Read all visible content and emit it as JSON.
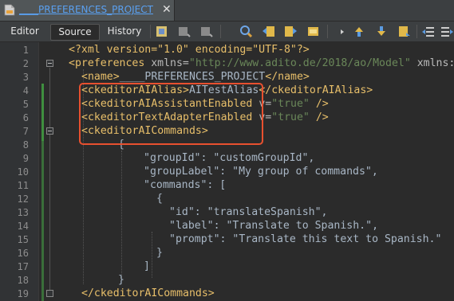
{
  "tab": {
    "title": "____PREFERENCES_PROJECT",
    "close": "✕"
  },
  "view_tabs": [
    "Editor",
    "Source",
    "History"
  ],
  "lines": [
    {
      "no": "1",
      "xml_decl": "<?xml version=\"1.0\" encoding=\"UTF-8\"?>"
    },
    {
      "no": "2",
      "open": "<preferences",
      "attr1": "xmlns=",
      "val1": "\"http://www.adito.de/2018/ao/Model\"",
      "attr2": "xmlns:"
    },
    {
      "no": "3",
      "open": "<name>",
      "text": "____PREFERENCES_PROJECT",
      "close": "</name>"
    },
    {
      "no": "4",
      "open": "<ckeditorAIAlias>",
      "text": "AITestAlias",
      "close": "</ckeditorAIAlias>"
    },
    {
      "no": "5",
      "open": "<ckeditorAIAssistantEnabled",
      "attr": "v=",
      "val": "\"true\"",
      "close": "/>"
    },
    {
      "no": "6",
      "open": "<ckeditorTextAdapterEnabled",
      "attr": "v=",
      "val": "\"true\"",
      "close": "/>"
    },
    {
      "no": "7",
      "open": "<ckeditorAICommands>"
    },
    {
      "no": "8",
      "text": "{"
    },
    {
      "no": "9",
      "text": "\"groupId\": \"customGroupId\","
    },
    {
      "no": "10",
      "text": "\"groupLabel\": \"My group of commands\","
    },
    {
      "no": "11",
      "text": "\"commands\": ["
    },
    {
      "no": "12",
      "text": "{"
    },
    {
      "no": "13",
      "text": "\"id\": \"translateSpanish\","
    },
    {
      "no": "14",
      "text": "\"label\": \"Translate to Spanish.\","
    },
    {
      "no": "15",
      "text": "\"prompt\": \"Translate this text to Spanish.\""
    },
    {
      "no": "16",
      "text": "}"
    },
    {
      "no": "17",
      "text": "]"
    },
    {
      "no": "18",
      "text": "}"
    },
    {
      "no": "19",
      "close": "</ckeditorAICommands>"
    }
  ],
  "colors": {
    "highlight": "#e8502f",
    "tag": "#e8bf6a",
    "string": "#6a8759",
    "text": "#a9b7c6"
  }
}
